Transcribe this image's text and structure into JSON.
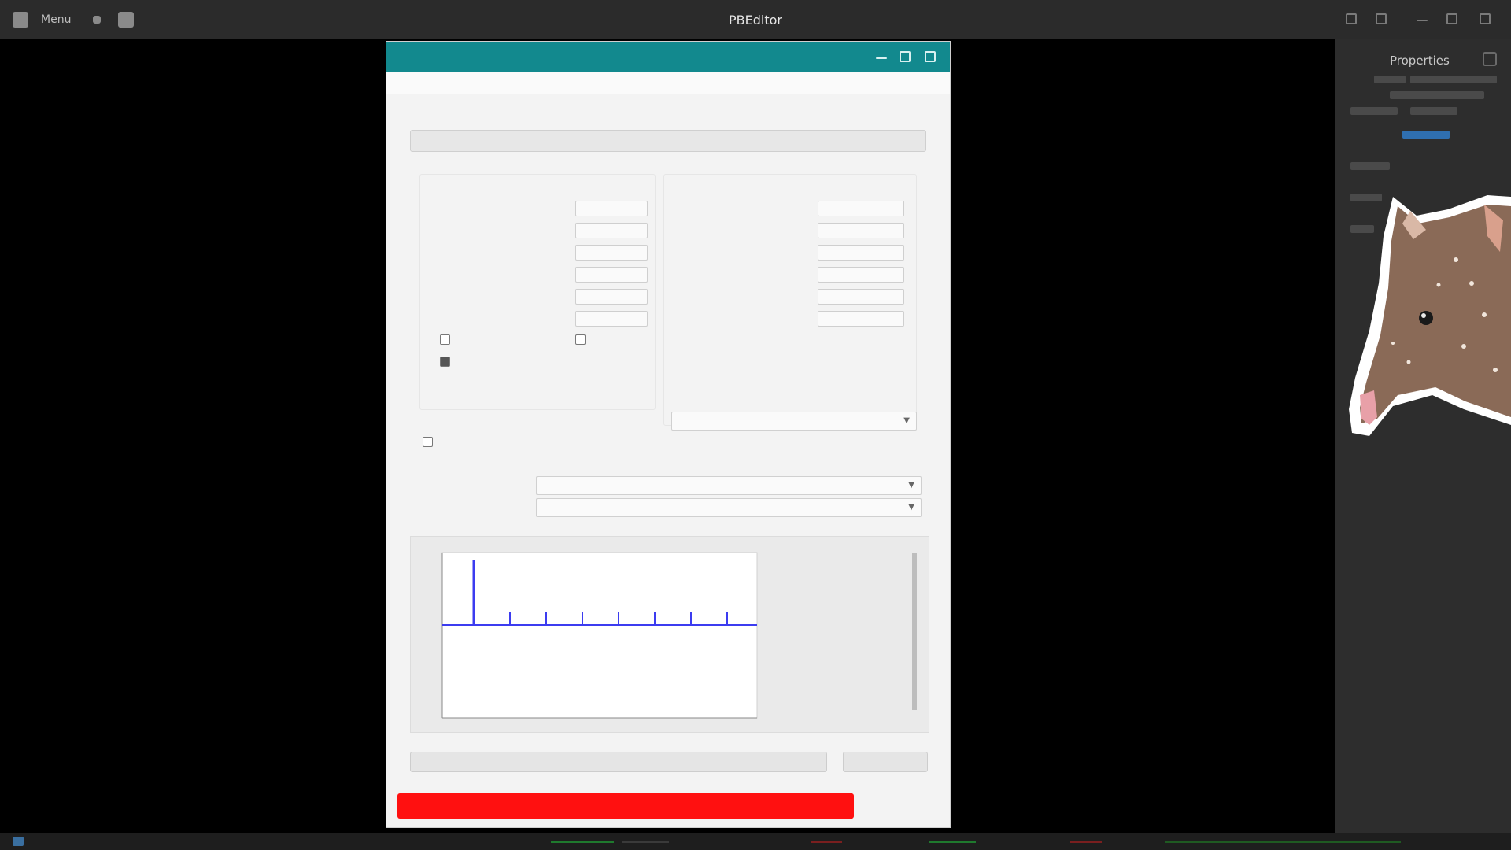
{
  "topbar": {
    "menu_label": "Menu",
    "title": "PBEditor"
  },
  "sidepanel": {
    "header": "Properties"
  },
  "app": {
    "window_title": "",
    "menu": [
      "",
      "",
      ""
    ],
    "section_title": "",
    "top_button": "",
    "group1": {
      "title": "",
      "rows": [
        {
          "label": "",
          "value": "",
          "checked": null
        },
        {
          "label": "",
          "value": "",
          "checked": null
        },
        {
          "label": "",
          "value": "",
          "checked": null
        },
        {
          "label": "",
          "value": "",
          "checked": null
        },
        {
          "label": "",
          "value": "",
          "checked": null
        },
        {
          "label": "",
          "value": "",
          "checked": null
        },
        {
          "label": "",
          "value": "",
          "checked": false
        },
        {
          "label": "",
          "value": "",
          "checked": true
        }
      ]
    },
    "group2": {
      "title": "",
      "rows": [
        {
          "label": "",
          "value": ""
        },
        {
          "label": "",
          "value": ""
        },
        {
          "label": "",
          "value": ""
        },
        {
          "label": "",
          "value": ""
        },
        {
          "label": "",
          "value": ""
        },
        {
          "label": "",
          "value": ""
        }
      ],
      "disabled_options": [
        "",
        "",
        ""
      ]
    },
    "option_row": {
      "label": "",
      "select_value": "",
      "checkbox_label": ""
    },
    "select_row_1": {
      "label": "",
      "value": ""
    },
    "select_row_2": {
      "label": "",
      "value": ""
    },
    "plot": {
      "ylabel": "",
      "xlabel": ""
    },
    "bottom_left_button": "",
    "bottom_right_button": "",
    "stop_button": "",
    "exit_button": ""
  },
  "colors": {
    "titlebar": "#12898e",
    "stop_button": "#ff1010",
    "plot_line": "#3c3cf0"
  }
}
